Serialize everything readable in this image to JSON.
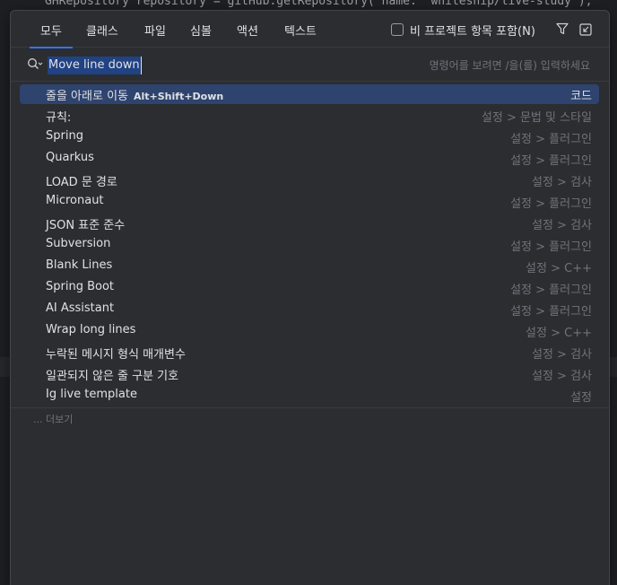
{
  "editor": {
    "snippet": "GHRepository repository = gitHub.getRepository( name: \"whiteship/live-study\");"
  },
  "tabs": [
    {
      "label": "모두",
      "active": true
    },
    {
      "label": "클래스",
      "active": false
    },
    {
      "label": "파일",
      "active": false
    },
    {
      "label": "심볼",
      "active": false
    },
    {
      "label": "액션",
      "active": false
    },
    {
      "label": "텍스트",
      "active": false
    }
  ],
  "options": {
    "include_non_project_label": "비 프로젝트 항목 포함(N)",
    "include_non_project_checked": false,
    "filter_icon": "filter-icon",
    "pin_icon": "open-in-window-icon"
  },
  "search": {
    "icon": "search-icon",
    "value": "Move line down",
    "hint": "명령어를 보려면 /을(를) 입력하세요"
  },
  "results": [
    {
      "label": "줄을 아래로 이동",
      "shortcut": "Alt+Shift+Down",
      "path": "코드",
      "selected": true
    },
    {
      "label": "규칙:",
      "shortcut": "",
      "path": "설정 > 문법 및 스타일",
      "selected": false
    },
    {
      "label": "Spring",
      "shortcut": "",
      "path": "설정 > 플러그인",
      "selected": false
    },
    {
      "label": "Quarkus",
      "shortcut": "",
      "path": "설정 > 플러그인",
      "selected": false
    },
    {
      "label": "LOAD 문 경로",
      "shortcut": "",
      "path": "설정 > 검사",
      "selected": false
    },
    {
      "label": "Micronaut",
      "shortcut": "",
      "path": "설정 > 플러그인",
      "selected": false
    },
    {
      "label": "JSON 표준 준수",
      "shortcut": "",
      "path": "설정 > 검사",
      "selected": false
    },
    {
      "label": "Subversion",
      "shortcut": "",
      "path": "설정 > 플러그인",
      "selected": false
    },
    {
      "label": "Blank Lines",
      "shortcut": "",
      "path": "설정 > C++",
      "selected": false
    },
    {
      "label": "Spring Boot",
      "shortcut": "",
      "path": "설정 > 플러그인",
      "selected": false
    },
    {
      "label": "AI Assistant",
      "shortcut": "",
      "path": "설정 > 플러그인",
      "selected": false
    },
    {
      "label": "Wrap long lines",
      "shortcut": "",
      "path": "설정 > C++",
      "selected": false
    },
    {
      "label": "누락된 메시지 형식 매개변수",
      "shortcut": "",
      "path": "설정 > 검사",
      "selected": false
    },
    {
      "label": "일관되지 않은 줄 구분 기호",
      "shortcut": "",
      "path": "설정 > 검사",
      "selected": false
    },
    {
      "label": "Ig live template",
      "shortcut": "",
      "path": "설정",
      "selected": false
    }
  ],
  "more_label": "... 더보기",
  "colors": {
    "accent": "#3574f0",
    "selection": "#2e436e",
    "popup_bg": "#2b2d30",
    "muted_text": "#6f737a"
  }
}
